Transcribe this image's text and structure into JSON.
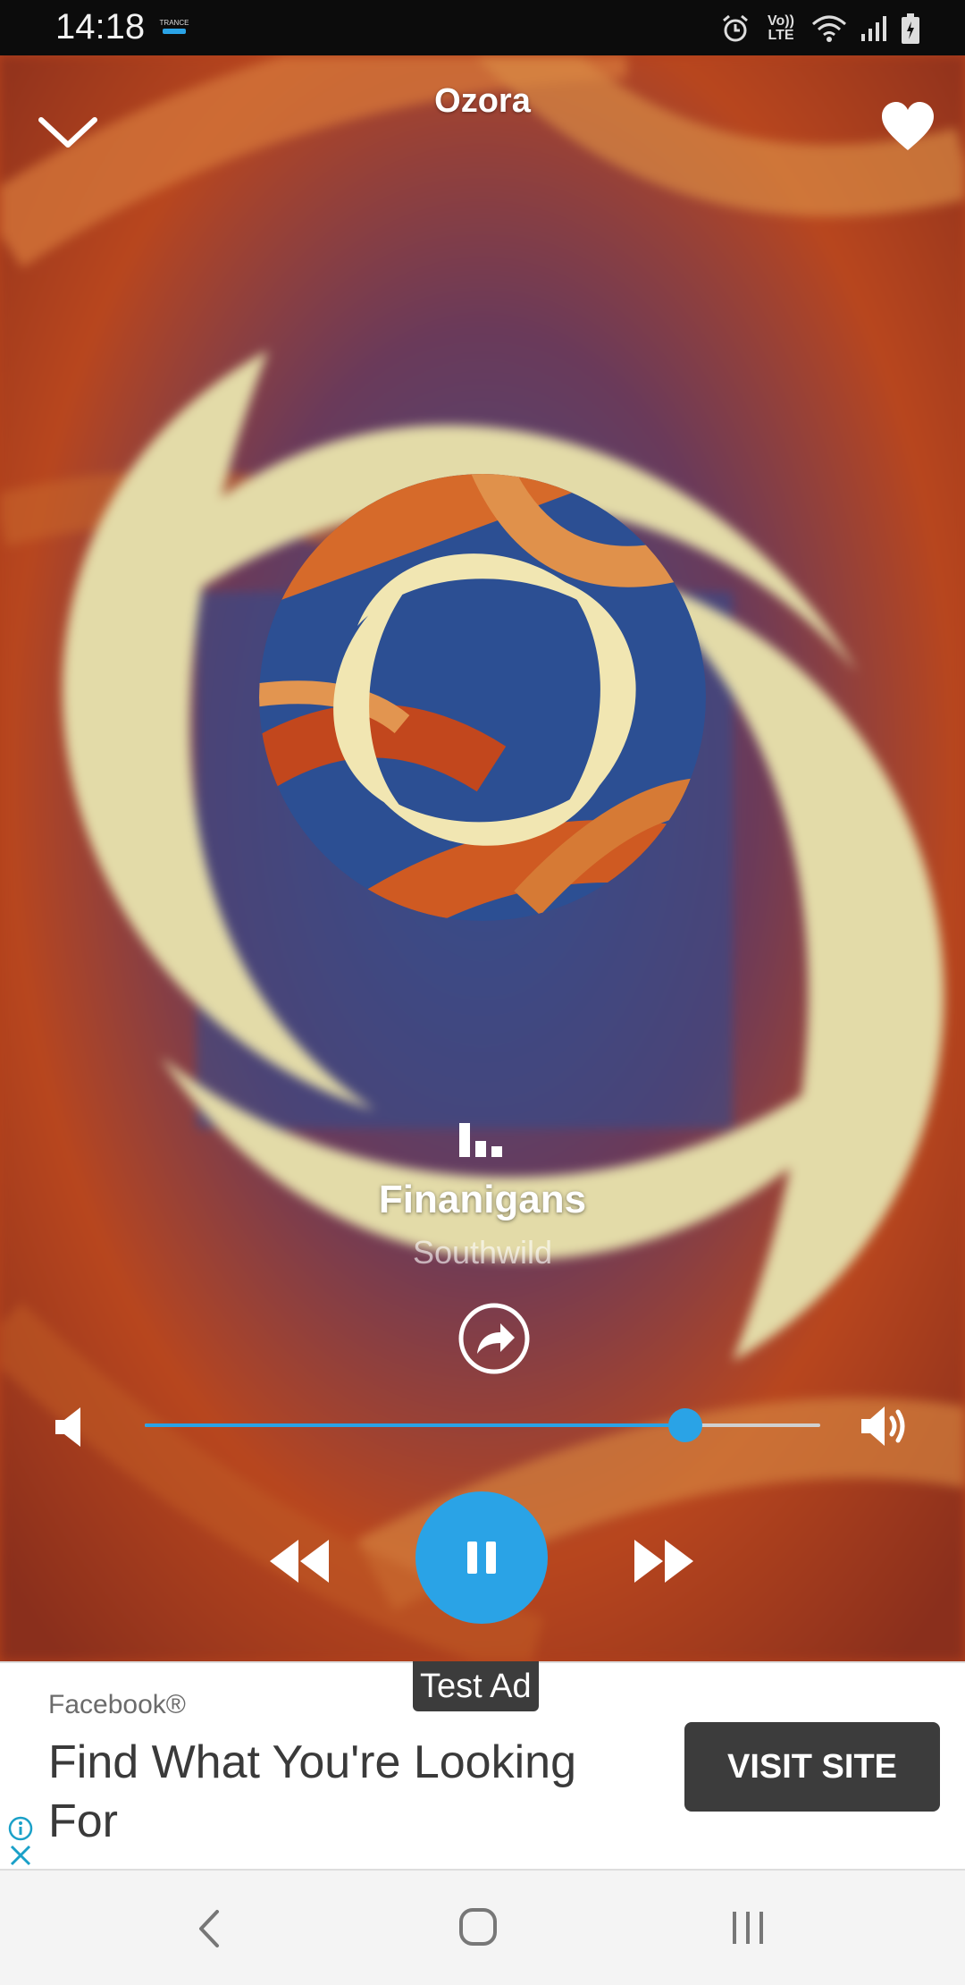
{
  "status_bar": {
    "time": "14:18",
    "app_icon_text": "TRANCE",
    "network_label": "Vo)) LTE",
    "icons": [
      "alarm-icon",
      "volte-icon",
      "wifi-icon",
      "signal-icon",
      "battery-icon"
    ]
  },
  "header": {
    "station_name": "Ozora",
    "icons": [
      "chevron-down-icon",
      "heart-icon"
    ]
  },
  "now_playing": {
    "title": "Finanigans",
    "artist": "Southwild",
    "icons": [
      "equalizer-icon",
      "share-icon"
    ]
  },
  "volume": {
    "level": 0.8,
    "icons": [
      "volume-low-icon",
      "volume-high-icon"
    ]
  },
  "controls": {
    "state": "playing",
    "icons": [
      "rewind-icon",
      "pause-icon",
      "fast-forward-icon"
    ]
  },
  "ad": {
    "label": "Test Ad",
    "advertiser": "Facebook®",
    "headline": "Find What You're Looking For",
    "cta": "VISIT SITE",
    "icons": [
      "info-icon",
      "close-icon"
    ]
  },
  "nav": {
    "icons": [
      "back-icon",
      "home-icon",
      "recents-icon"
    ]
  },
  "colors": {
    "accent": "#2aa3e6",
    "art_cream": "#e3dba8",
    "art_orange": "#c7521e",
    "art_blue": "#284f8c"
  }
}
